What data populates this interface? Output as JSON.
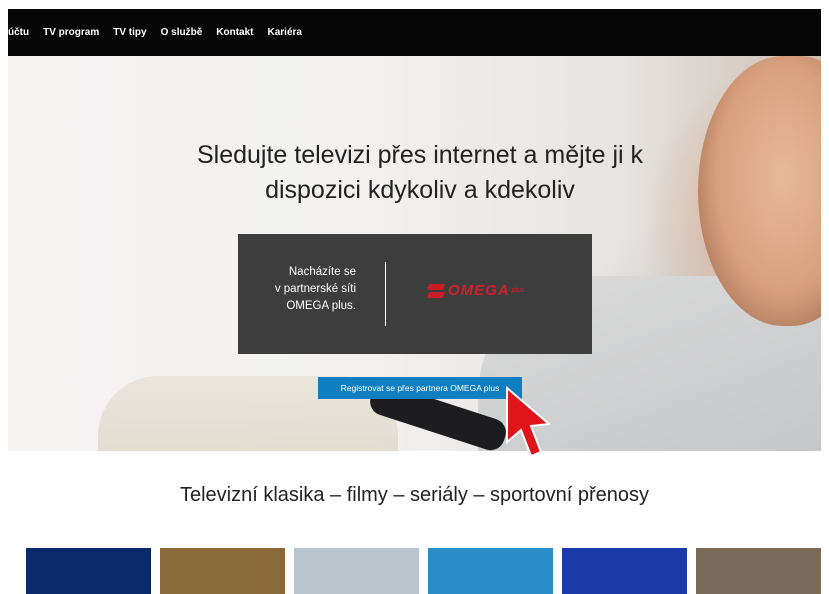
{
  "nav": {
    "items": [
      "účtu",
      "TV program",
      "TV tipy",
      "O službě",
      "Kontakt",
      "Kariéra"
    ]
  },
  "hero": {
    "headline": "Sledujte televizi přes internet a mějte ji k dispozici kdykoliv a kdekoliv",
    "partner_text": "Nacházíte se\nv partnerské síti\nOMEGA plus.",
    "partner_logo_text": "OMEGA",
    "partner_logo_suffix": "plus",
    "register_label": "Registrovat se přes partnera OMEGA plus"
  },
  "section": {
    "title": "Televizní klasika – filmy – seriály – sportovní přenosy"
  },
  "thumbnails": [
    {
      "name": "thumb-space-movie",
      "color": "#0b2a6a"
    },
    {
      "name": "thumb-comedy-poster",
      "color": "#8a6a3a"
    },
    {
      "name": "thumb-winter-scene",
      "color": "#b9c4cc"
    },
    {
      "name": "thumb-underwater",
      "color": "#2a8fc9"
    },
    {
      "name": "thumb-blue-space",
      "color": "#1a3aa8"
    },
    {
      "name": "thumb-portrait",
      "color": "#7a6a5a"
    }
  ],
  "colors": {
    "nav_bg": "#060606",
    "button_bg": "#0f7fc2",
    "partner_box_bg": "#3d3d3d",
    "logo_red": "#d0202a",
    "cursor_red": "#e1141c"
  }
}
